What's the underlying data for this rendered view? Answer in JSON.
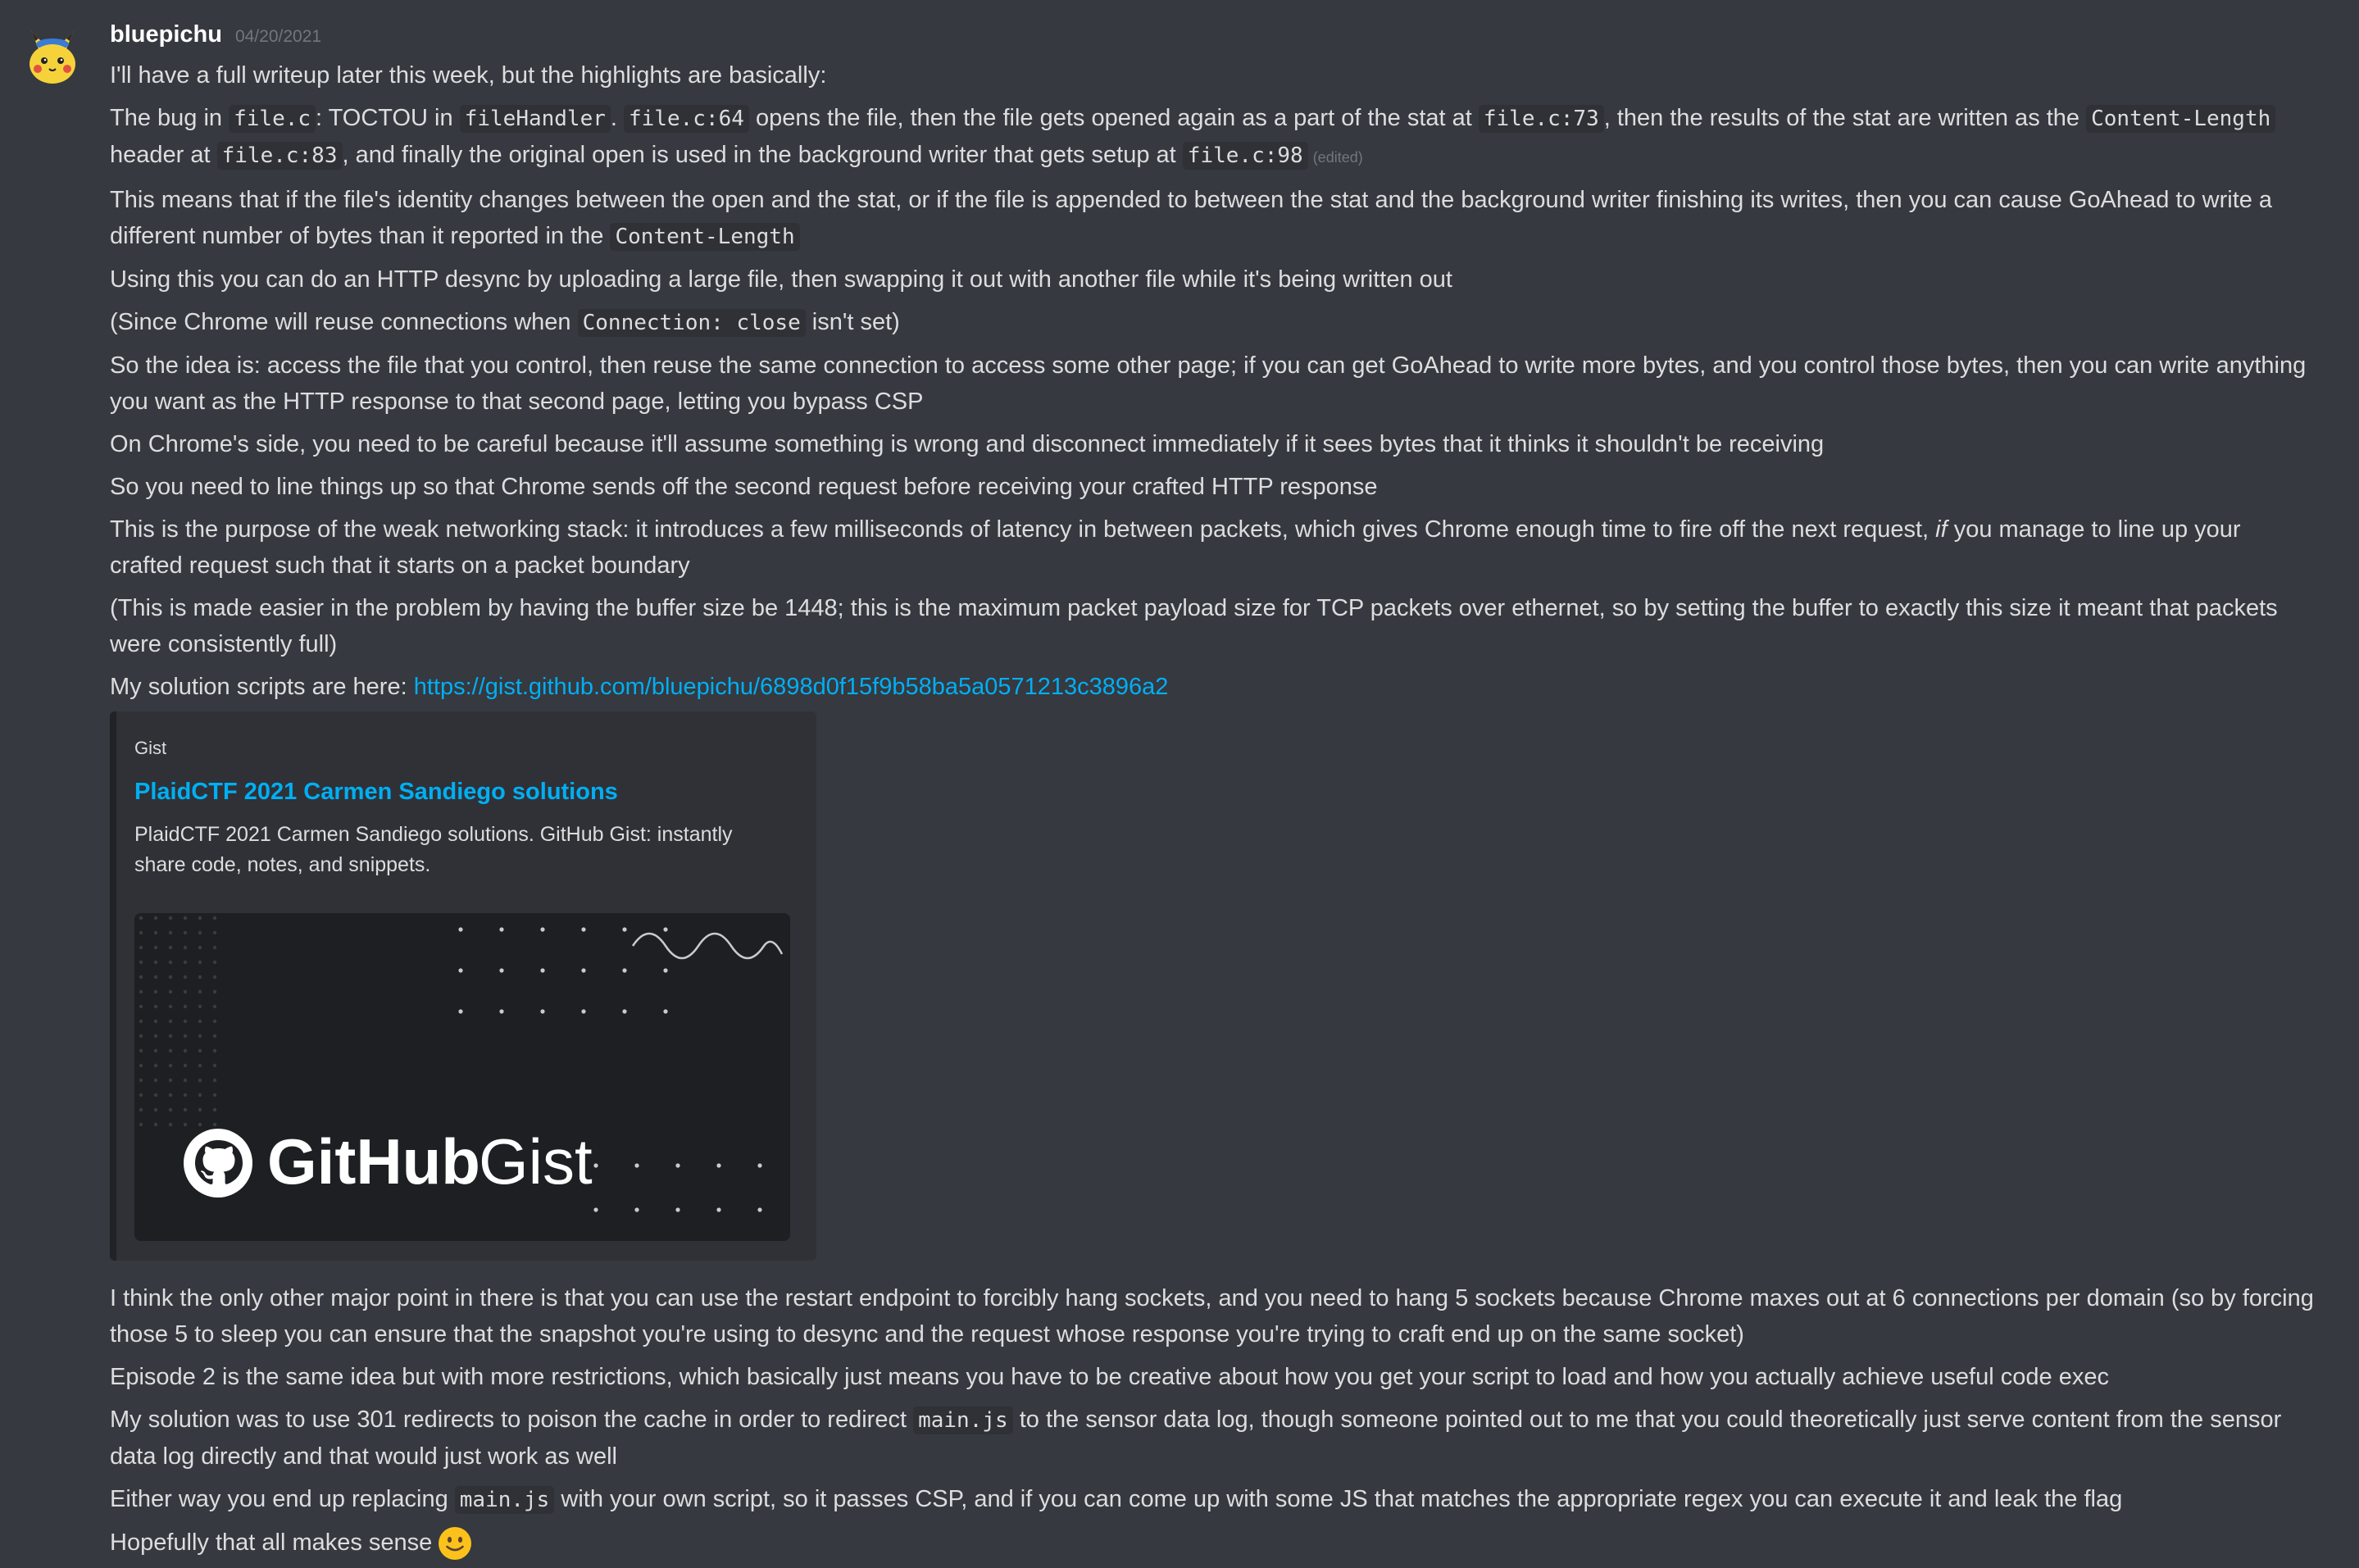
{
  "message": {
    "author": "bluepichu",
    "timestamp": "04/20/2021",
    "edited_label": "(edited)",
    "lines": {
      "l1": "I'll have a full writeup later this week, but the highlights are basically:",
      "l2": {
        "t1": "The bug in ",
        "c1": "file.c",
        "t2": ": TOCTOU in ",
        "c2": "fileHandler",
        "t3": ". ",
        "c3": "file.c:64",
        "t4": " opens the file, then the file gets opened again as a part of the stat at ",
        "c4": "file.c:73",
        "t5": ", then the results of the stat are written as the ",
        "c5": "Content-Length",
        "t6": " header at ",
        "c6": "file.c:83",
        "t7": ", and finally the original open is used in the background writer that gets setup at ",
        "c7": "file.c:98"
      },
      "l3": {
        "t1": "This means that if the file's identity changes between the open and the stat, or if the file is appended to between the stat and the background writer finishing its writes, then you can cause GoAhead to write a different number of bytes than it reported in the ",
        "c1": "Content-Length"
      },
      "l4": "Using this you can do an HTTP desync by uploading a large file, then swapping it out with another file while it's being written out",
      "l5": {
        "t1": "(Since Chrome will reuse connections when ",
        "c1": "Connection: close",
        "t2": " isn't set)"
      },
      "l6": "So the idea is: access the file that you control, then reuse the same connection to access some other page; if you can get GoAhead to write more bytes, and you control those bytes, then you can write anything you want as the HTTP response to that second page, letting you bypass CSP",
      "l7": "On Chrome's side, you need to be careful because it'll assume something is wrong and disconnect immediately if it sees bytes that it thinks it shouldn't be receiving",
      "l8": "So you need to line things up so that Chrome sends off the second request before receiving your crafted HTTP response",
      "l9": {
        "t1": "This is the purpose of the weak networking stack: it introduces a few milliseconds of latency in between packets, which gives Chrome enough time to fire off the next request, ",
        "em": "if",
        "t2": " you manage to line up your crafted request such that it starts on a packet boundary"
      },
      "l10": "(This is made easier in the problem by having the buffer size be 1448; this is the maximum packet payload size for TCP packets over ethernet, so by setting the buffer to exactly this size it meant that packets were consistently full)",
      "l11": {
        "t1": "My solution scripts are here: ",
        "link": "https://gist.github.com/bluepichu/6898d0f15f9b58ba5a0571213c3896a2"
      },
      "l12": "I think the only other major point in there is that you can use the restart endpoint to forcibly hang sockets, and you need to hang 5 sockets because Chrome maxes out at 6 connections per domain (so by forcing those 5 to sleep you can ensure that the snapshot you're using to desync and the request whose response you're trying to craft end up on the same socket)",
      "l13": "Episode 2 is the same idea but with more restrictions, which basically just means you have to be creative about how you get your script to load and how you actually achieve useful code exec",
      "l14": {
        "t1": "My solution was to use 301 redirects to poison the cache in order to redirect ",
        "c1": "main.js",
        "t2": " to the sensor data log, though someone pointed out to me that you could theoretically just serve content from the sensor data log directly and that would just work as well"
      },
      "l15": {
        "t1": "Either way you end up replacing ",
        "c1": "main.js",
        "t2": " with your own script, so it passes CSP, and if you can come up with some JS that matches the appropriate regex you can execute it and leak the flag"
      },
      "l16": "Hopefully that all makes sense"
    }
  },
  "embed": {
    "provider": "Gist",
    "title": "PlaidCTF 2021 Carmen Sandiego solutions",
    "description": "PlaidCTF 2021 Carmen Sandiego solutions. GitHub Gist: instantly share code, notes, and snippets.",
    "image_logo_text_bold": "GitHub",
    "image_logo_text_light": "Gist"
  },
  "colors": {
    "background": "#36393f",
    "link": "#00aff4",
    "embed_bg": "#2f3136",
    "emoji_face": "#fcc21b"
  },
  "icons": {
    "avatar": "pikachu-avatar",
    "emoji": "slightly-smiling-face-emoji",
    "github": "github-octocat-icon"
  }
}
